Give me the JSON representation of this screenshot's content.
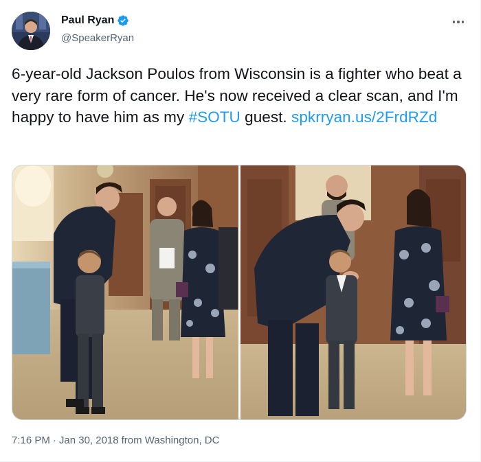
{
  "author": {
    "display_name": "Paul Ryan",
    "handle": "@SpeakerRyan",
    "avatar_icon": "profile-photo",
    "verified_icon": "verified-badge-icon",
    "verified_color": "#1d9bf0"
  },
  "menu": {
    "icon": "more-options-icon"
  },
  "tweet": {
    "text_before_hashtag": "6-year-old Jackson Poulos from Wisconsin is a fighter who beat a very rare form of cancer. He's now received a clear scan, and I'm happy to have him as my ",
    "hashtag": "#SOTU",
    "text_after_hashtag": " guest. ",
    "link": "spkrryan.us/2FrdRZd",
    "link_color": "#1d9bf0"
  },
  "media": {
    "photo_count": 2,
    "photos": [
      {
        "icon": "photo-left"
      },
      {
        "icon": "photo-right"
      }
    ]
  },
  "meta": {
    "time": "7:16 PM",
    "separator": "·",
    "date": "Jan 30, 2018",
    "location": "from Washington, DC"
  }
}
